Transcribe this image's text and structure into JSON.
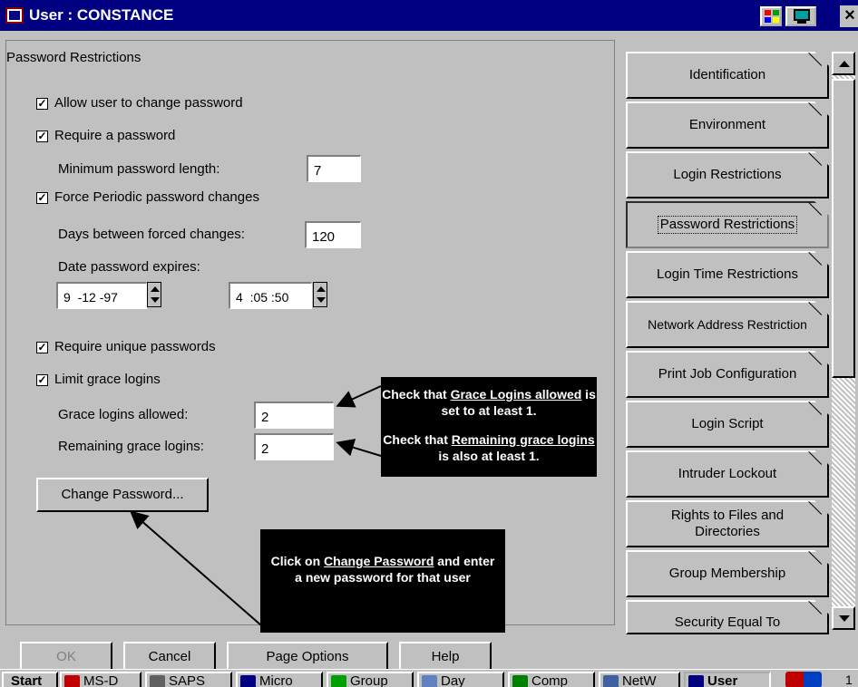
{
  "window": {
    "title": "User : CONSTANCE",
    "close": "×"
  },
  "panel": {
    "legend": "Password Restrictions",
    "allow_change": {
      "label": "Allow user to change password",
      "checked": true
    },
    "require_password": {
      "label": "Require a password",
      "checked": true
    },
    "min_length": {
      "label": "Minimum password length:",
      "value": "7"
    },
    "force_periodic": {
      "label": "Force Periodic password changes",
      "checked": true
    },
    "days_between": {
      "label": "Days between forced changes:",
      "value": "120"
    },
    "expires": {
      "label": "Date password expires:",
      "date": "9  -12 -97",
      "time": "4  :05 :50"
    },
    "require_unique": {
      "label": "Require unique passwords",
      "checked": true
    },
    "limit_grace": {
      "label": "Limit grace logins",
      "checked": true
    },
    "grace_allowed": {
      "label": "Grace logins allowed:",
      "value": "2"
    },
    "remaining_grace": {
      "label": "Remaining grace logins:",
      "value": "2"
    },
    "change_password_button": "Change Password..."
  },
  "callouts": {
    "grace_pre": "Check that ",
    "grace_link": "Grace Logins allowed",
    "grace_post": " is set to at least 1.",
    "remaining_pre": "Check that ",
    "remaining_link": "Remaining grace logins",
    "remaining_post": " is also at least 1.",
    "change_pre": "Click on ",
    "change_link": "Change Password",
    "change_post": " and enter a new password for that user"
  },
  "tabs": [
    "Identification",
    "Environment",
    "Login Restrictions",
    "Password Restrictions",
    "Login Time Restrictions",
    "Network Address Restriction",
    "Print Job Configuration",
    "Login Script",
    "Intruder Lockout",
    "Rights to Files and Directories",
    "Group Membership",
    "Security Equal To"
  ],
  "active_tab": "Password Restrictions",
  "bottom_buttons": {
    "ok": "OK",
    "cancel": "Cancel",
    "page_options": "Page Options",
    "help": "Help"
  },
  "taskbar": {
    "start": "Start",
    "items": [
      "MS-D",
      "SAPS",
      "Micro",
      "Group",
      "Day",
      "Comp",
      "NetW",
      "User"
    ],
    "clock": "1"
  },
  "colors": {
    "titlebar": "#000080",
    "face": "#c0c0c0",
    "callout": "#000000"
  }
}
